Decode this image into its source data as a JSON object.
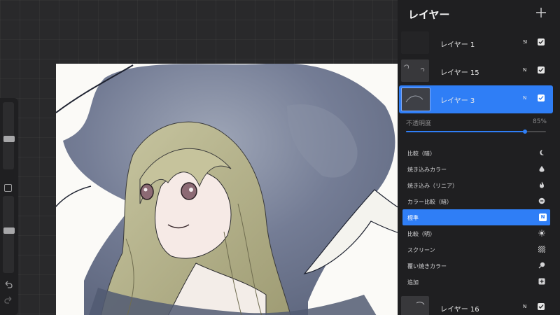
{
  "panel": {
    "title": "レイヤー",
    "add_icon": "plus-icon"
  },
  "layers": [
    {
      "name": "レイヤー 1",
      "blend": "SI",
      "visible": true,
      "active": false
    },
    {
      "name": "レイヤー 15",
      "blend": "N",
      "visible": true,
      "active": false
    },
    {
      "name": "レイヤー 3",
      "blend": "N",
      "visible": true,
      "active": true
    },
    {
      "name": "レイヤー 16",
      "blend": "N",
      "visible": true,
      "active": false
    }
  ],
  "opacity": {
    "label": "不透明度",
    "value_text": "85%",
    "value": 0.85
  },
  "blend_modes": [
    {
      "label": "比較（暗）",
      "icon": "crescent-moon-icon",
      "active": false
    },
    {
      "label": "焼き込みカラー",
      "icon": "burn-drop-icon",
      "active": false
    },
    {
      "label": "焼き込み（リニア）",
      "icon": "flame-icon",
      "active": false
    },
    {
      "label": "カラー比較（暗）",
      "icon": "minus-circle-icon",
      "active": false
    },
    {
      "label": "標準",
      "icon": "n-badge",
      "badge": "N",
      "active": true
    },
    {
      "label": "比較（明）",
      "icon": "sun-icon",
      "active": false
    },
    {
      "label": "スクリーン",
      "icon": "hatch-icon",
      "active": false
    },
    {
      "label": "覆い焼きカラー",
      "icon": "dodge-icon",
      "active": false
    },
    {
      "label": "追加",
      "icon": "plus-square-icon",
      "active": false
    }
  ],
  "sidebar": {
    "brush_size_level": 0.45,
    "brush_opacity_level": 0.55,
    "modify_icon": "square-icon",
    "undo_icon": "undo-icon",
    "redo_icon": "redo-icon"
  },
  "colors": {
    "accent": "#2f7ef6",
    "panel_bg": "#1f1f21",
    "canvas_bg": "#29292b"
  }
}
